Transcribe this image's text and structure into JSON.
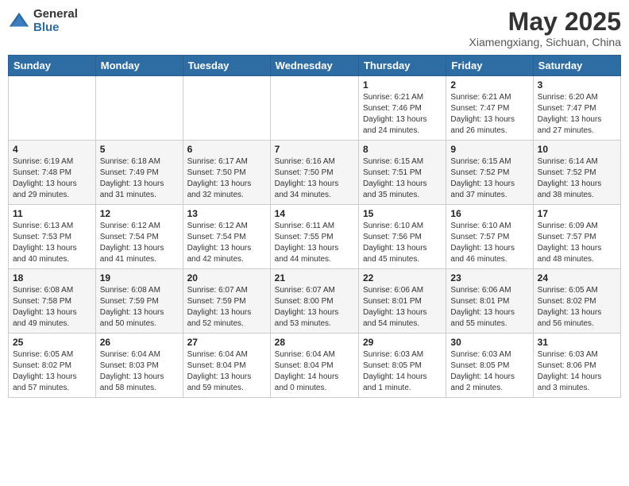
{
  "header": {
    "logo_general": "General",
    "logo_blue": "Blue",
    "month": "May 2025",
    "location": "Xiamengxiang, Sichuan, China"
  },
  "weekdays": [
    "Sunday",
    "Monday",
    "Tuesday",
    "Wednesday",
    "Thursday",
    "Friday",
    "Saturday"
  ],
  "weeks": [
    [
      {
        "day": "",
        "info": ""
      },
      {
        "day": "",
        "info": ""
      },
      {
        "day": "",
        "info": ""
      },
      {
        "day": "",
        "info": ""
      },
      {
        "day": "1",
        "info": "Sunrise: 6:21 AM\nSunset: 7:46 PM\nDaylight: 13 hours\nand 24 minutes."
      },
      {
        "day": "2",
        "info": "Sunrise: 6:21 AM\nSunset: 7:47 PM\nDaylight: 13 hours\nand 26 minutes."
      },
      {
        "day": "3",
        "info": "Sunrise: 6:20 AM\nSunset: 7:47 PM\nDaylight: 13 hours\nand 27 minutes."
      }
    ],
    [
      {
        "day": "4",
        "info": "Sunrise: 6:19 AM\nSunset: 7:48 PM\nDaylight: 13 hours\nand 29 minutes."
      },
      {
        "day": "5",
        "info": "Sunrise: 6:18 AM\nSunset: 7:49 PM\nDaylight: 13 hours\nand 31 minutes."
      },
      {
        "day": "6",
        "info": "Sunrise: 6:17 AM\nSunset: 7:50 PM\nDaylight: 13 hours\nand 32 minutes."
      },
      {
        "day": "7",
        "info": "Sunrise: 6:16 AM\nSunset: 7:50 PM\nDaylight: 13 hours\nand 34 minutes."
      },
      {
        "day": "8",
        "info": "Sunrise: 6:15 AM\nSunset: 7:51 PM\nDaylight: 13 hours\nand 35 minutes."
      },
      {
        "day": "9",
        "info": "Sunrise: 6:15 AM\nSunset: 7:52 PM\nDaylight: 13 hours\nand 37 minutes."
      },
      {
        "day": "10",
        "info": "Sunrise: 6:14 AM\nSunset: 7:52 PM\nDaylight: 13 hours\nand 38 minutes."
      }
    ],
    [
      {
        "day": "11",
        "info": "Sunrise: 6:13 AM\nSunset: 7:53 PM\nDaylight: 13 hours\nand 40 minutes."
      },
      {
        "day": "12",
        "info": "Sunrise: 6:12 AM\nSunset: 7:54 PM\nDaylight: 13 hours\nand 41 minutes."
      },
      {
        "day": "13",
        "info": "Sunrise: 6:12 AM\nSunset: 7:54 PM\nDaylight: 13 hours\nand 42 minutes."
      },
      {
        "day": "14",
        "info": "Sunrise: 6:11 AM\nSunset: 7:55 PM\nDaylight: 13 hours\nand 44 minutes."
      },
      {
        "day": "15",
        "info": "Sunrise: 6:10 AM\nSunset: 7:56 PM\nDaylight: 13 hours\nand 45 minutes."
      },
      {
        "day": "16",
        "info": "Sunrise: 6:10 AM\nSunset: 7:57 PM\nDaylight: 13 hours\nand 46 minutes."
      },
      {
        "day": "17",
        "info": "Sunrise: 6:09 AM\nSunset: 7:57 PM\nDaylight: 13 hours\nand 48 minutes."
      }
    ],
    [
      {
        "day": "18",
        "info": "Sunrise: 6:08 AM\nSunset: 7:58 PM\nDaylight: 13 hours\nand 49 minutes."
      },
      {
        "day": "19",
        "info": "Sunrise: 6:08 AM\nSunset: 7:59 PM\nDaylight: 13 hours\nand 50 minutes."
      },
      {
        "day": "20",
        "info": "Sunrise: 6:07 AM\nSunset: 7:59 PM\nDaylight: 13 hours\nand 52 minutes."
      },
      {
        "day": "21",
        "info": "Sunrise: 6:07 AM\nSunset: 8:00 PM\nDaylight: 13 hours\nand 53 minutes."
      },
      {
        "day": "22",
        "info": "Sunrise: 6:06 AM\nSunset: 8:01 PM\nDaylight: 13 hours\nand 54 minutes."
      },
      {
        "day": "23",
        "info": "Sunrise: 6:06 AM\nSunset: 8:01 PM\nDaylight: 13 hours\nand 55 minutes."
      },
      {
        "day": "24",
        "info": "Sunrise: 6:05 AM\nSunset: 8:02 PM\nDaylight: 13 hours\nand 56 minutes."
      }
    ],
    [
      {
        "day": "25",
        "info": "Sunrise: 6:05 AM\nSunset: 8:02 PM\nDaylight: 13 hours\nand 57 minutes."
      },
      {
        "day": "26",
        "info": "Sunrise: 6:04 AM\nSunset: 8:03 PM\nDaylight: 13 hours\nand 58 minutes."
      },
      {
        "day": "27",
        "info": "Sunrise: 6:04 AM\nSunset: 8:04 PM\nDaylight: 13 hours\nand 59 minutes."
      },
      {
        "day": "28",
        "info": "Sunrise: 6:04 AM\nSunset: 8:04 PM\nDaylight: 14 hours\nand 0 minutes."
      },
      {
        "day": "29",
        "info": "Sunrise: 6:03 AM\nSunset: 8:05 PM\nDaylight: 14 hours\nand 1 minute."
      },
      {
        "day": "30",
        "info": "Sunrise: 6:03 AM\nSunset: 8:05 PM\nDaylight: 14 hours\nand 2 minutes."
      },
      {
        "day": "31",
        "info": "Sunrise: 6:03 AM\nSunset: 8:06 PM\nDaylight: 14 hours\nand 3 minutes."
      }
    ]
  ]
}
